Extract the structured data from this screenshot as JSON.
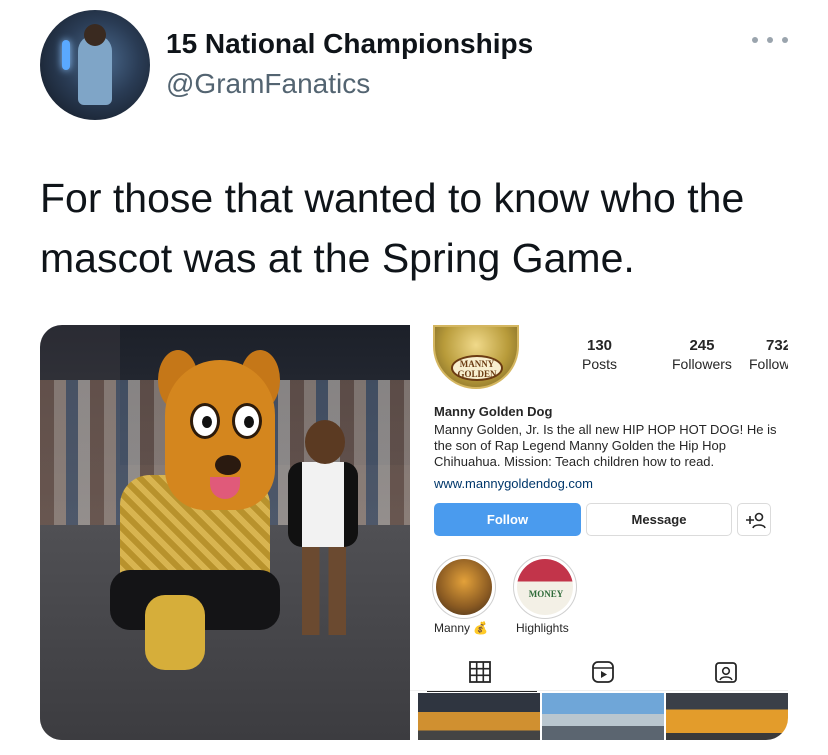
{
  "tweet": {
    "display_name": "15 National Championships",
    "handle": "@GramFanatics",
    "text": "For those that wanted to know who the mascot was at the Spring Game."
  },
  "instagram": {
    "stats": [
      {
        "value": "130",
        "label": "Posts"
      },
      {
        "value": "245",
        "label": "Followers"
      },
      {
        "value": "732",
        "label": "Following"
      }
    ],
    "avatar_badge": "MANNY GOLDEN",
    "name": "Manny Golden Dog",
    "bio": "Manny Golden, Jr. Is the all new HIP HOP HOT DOG! He is the son of Rap Legend Manny Golden the Hip Hop Chihuahua. Mission: Teach children how to read.",
    "link": "www.mannygoldendog.com",
    "follow_label": "Follow",
    "message_label": "Message",
    "highlights": [
      {
        "label": "Manny 💰"
      },
      {
        "label": "Highlights",
        "badge": "MONEY"
      }
    ]
  },
  "icons": [
    "more-icon",
    "add-person-icon",
    "grid-icon",
    "reels-icon",
    "tagged-icon"
  ]
}
